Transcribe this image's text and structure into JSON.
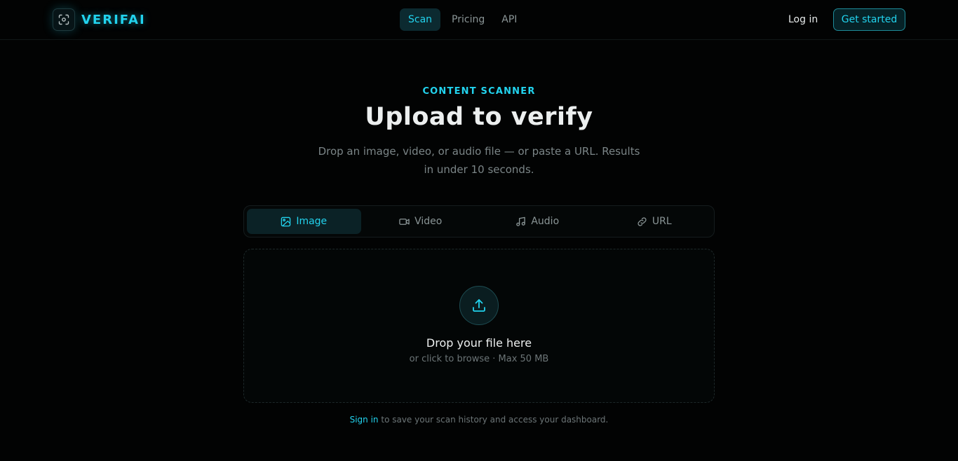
{
  "header": {
    "brand": "VERIFAI",
    "logo_icon": "scan-focus-icon",
    "nav": [
      {
        "label": "Scan",
        "active": true
      },
      {
        "label": "Pricing",
        "active": false
      },
      {
        "label": "API",
        "active": false
      }
    ],
    "login_label": "Log in",
    "cta_label": "Get started"
  },
  "hero": {
    "eyebrow": "CONTENT SCANNER",
    "title": "Upload to verify",
    "subtitle": "Drop an image, video, or audio file — or paste a URL. Results in under 10 seconds."
  },
  "tabs": [
    {
      "label": "Image",
      "icon": "image-icon",
      "active": true
    },
    {
      "label": "Video",
      "icon": "video-icon",
      "active": false
    },
    {
      "label": "Audio",
      "icon": "music-icon",
      "active": false
    },
    {
      "label": "URL",
      "icon": "link-icon",
      "active": false
    }
  ],
  "dropzone": {
    "icon": "upload-icon",
    "title": "Drop your file here",
    "subtitle": "or click to browse · Max 50 MB"
  },
  "footer": {
    "signin_label": "Sign in",
    "text": " to save your scan history and access your dashboard."
  },
  "colors": {
    "accent": "#22d3ee",
    "background": "#020303"
  }
}
